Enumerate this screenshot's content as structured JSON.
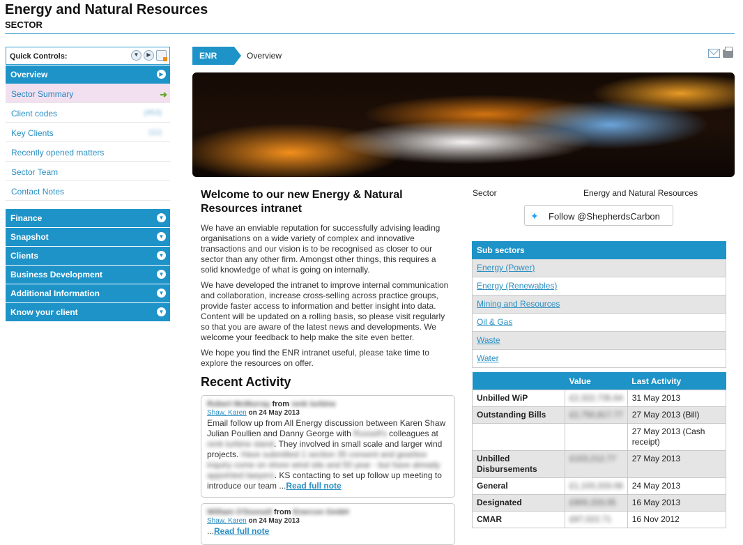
{
  "header": {
    "title": "Energy and Natural Resources",
    "subtitle": "SECTOR"
  },
  "quick_controls": {
    "label": "Quick Controls:"
  },
  "nav": {
    "overview": "Overview",
    "items": [
      {
        "label": "Sector Summary",
        "count": ""
      },
      {
        "label": "Client codes",
        "count": "(453)"
      },
      {
        "label": "Key Clients",
        "count": "(11)"
      },
      {
        "label": "Recently opened matters",
        "count": ""
      },
      {
        "label": "Sector Team",
        "count": ""
      },
      {
        "label": "Contact Notes",
        "count": ""
      }
    ],
    "sections": [
      "Finance",
      "Snapshot",
      "Clients",
      "Business Development",
      "Additional Information",
      "Know your client"
    ]
  },
  "breadcrumb": {
    "root": "ENR",
    "current": "Overview"
  },
  "welcome": {
    "title": "Welcome to our new Energy & Natural Resources intranet",
    "p1": "We have an enviable reputation for successfully advising leading organisations on a wide variety of complex and innovative transactions and our vision is to be recognised as closer to our sector than any other firm.  Amongst other things, this requires a solid knowledge of what is going on internally.",
    "p2": "We have developed the intranet to improve internal communication and collaboration, increase cross-selling across practice groups, provide faster access to information and better insight into data. Content will be updated on a rolling basis, so please visit regularly so that you are aware of the latest news and developments. We welcome your feedback to help make the site even better.",
    "p3": "We hope you find the ENR intranet useful, please take time to explore the resources on offer."
  },
  "recent_activity": {
    "title": "Recent Activity",
    "items": [
      {
        "person": "Robert McMurray",
        "from_label": "from",
        "org": "renk turbine",
        "author": "Shaw, Karen",
        "date_prefix": "on",
        "date": "24 May 2013",
        "body_a": "Email follow up from All Energy discussion between Karen Shaw Julian Poullien and Danny George with",
        "body_b": "Russell's",
        "body_c": "colleagues at",
        "body_d": "renk turbine stand",
        "body_e": ". They involved in small scale and larger wind projects.",
        "body_f": "Have submitted 1 section 35 consent and gearbox inquiry come on shore wind site and 50 year - but have already appointed lawyers",
        "body_g": ". KS contacting to set up follow up meeting to introduce our team ...",
        "more": "Read full note"
      },
      {
        "person": "William O'Donnell",
        "from_label": "from",
        "org": "Enercon GmbH",
        "author": "Shaw, Karen",
        "date_prefix": "on",
        "date": "24 May 2013",
        "lead": "...",
        "more": "Read full note"
      }
    ]
  },
  "sector_info": {
    "label": "Sector",
    "value": "Energy and Natural Resources"
  },
  "twitter": {
    "label": "Follow @ShepherdsCarbon"
  },
  "sub_sectors": {
    "header": "Sub sectors",
    "items": [
      "Energy (Power)",
      "Energy (Renewables)",
      "Mining and Resources",
      "Oil & Gas",
      "Waste",
      "Water"
    ]
  },
  "financials": {
    "headers": [
      "",
      "Value",
      "Last Activity"
    ],
    "rows": [
      {
        "label": "Unbilled WiP",
        "value": "£2,322,735.64",
        "activity": "31 May 2013"
      },
      {
        "label": "Outstanding Bills",
        "value": "£2,750,817.77",
        "activity": "27 May 2013 (Bill)"
      },
      {
        "label": "",
        "value": "",
        "activity": "27 May 2013 (Cash receipt)"
      },
      {
        "label": "Unbilled Disbursements",
        "value": "£153,212.77",
        "activity": "27 May 2013"
      },
      {
        "label": "General",
        "value": "£1,103,333.06",
        "activity": "24 May 2013"
      },
      {
        "label": "Designated",
        "value": "£900,333.05",
        "activity": "16 May 2013"
      },
      {
        "label": "CMAR",
        "value": "£87,022.71",
        "activity": "16 Nov 2012"
      }
    ]
  }
}
